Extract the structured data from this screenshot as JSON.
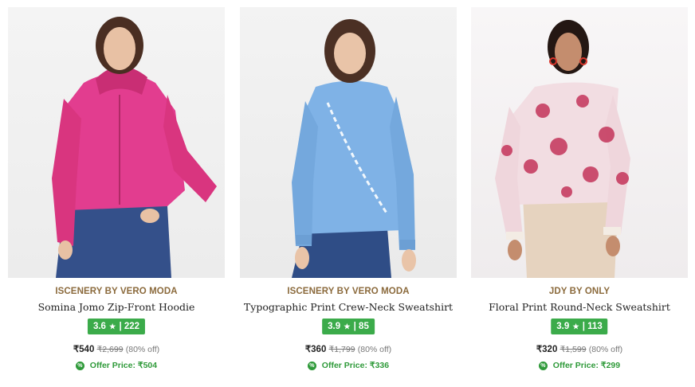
{
  "products": [
    {
      "brand": "ISCENERY BY VERO MODA",
      "title": "Somina Jomo Zip-Front Hoodie",
      "rating": "3.6",
      "reviews": "222",
      "price": "₹540",
      "mrp": "₹2,699",
      "discount": "(80% off)",
      "offer_label": "Offer Price:",
      "offer_price": "₹504",
      "garment_color": "#e23d8f"
    },
    {
      "brand": "ISCENERY BY VERO MODA",
      "title": "Typographic Print Crew-Neck Sweatshirt",
      "rating": "3.9",
      "reviews": "85",
      "price": "₹360",
      "mrp": "₹1,799",
      "discount": "(80% off)",
      "offer_label": "Offer Price:",
      "offer_price": "₹336",
      "garment_color": "#7fb2e6"
    },
    {
      "brand": "JDY BY ONLY",
      "title": "Floral Print Round-Neck Sweatshirt",
      "rating": "3.9",
      "reviews": "113",
      "price": "₹320",
      "mrp": "₹1,599",
      "discount": "(80% off)",
      "offer_label": "Offer Price:",
      "offer_price": "₹299",
      "garment_color": "#e7a6b6"
    }
  ],
  "star_glyph": "★",
  "separator": "|",
  "offer_badge_glyph": "%",
  "colors": {
    "brand_text": "#8b6a3c",
    "rating_bg": "#3bab4a",
    "offer_text": "#2f9a3a"
  }
}
